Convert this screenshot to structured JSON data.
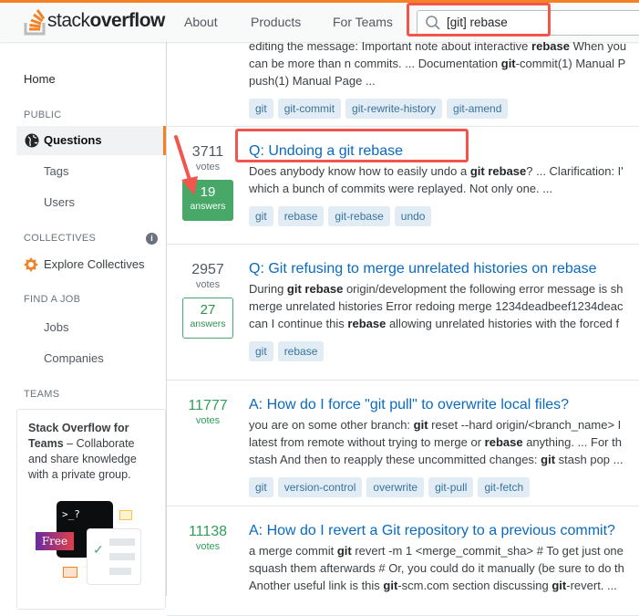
{
  "header": {
    "logo": {
      "stack": "stack",
      "overflow": "overflow"
    },
    "nav": [
      "About",
      "Products",
      "For Teams"
    ],
    "search_value": "[git] rebase"
  },
  "sidebar": {
    "home": "Home",
    "public": "PUBLIC",
    "questions": "Questions",
    "tags": "Tags",
    "users": "Users",
    "collectives": "COLLECTIVES",
    "explore": "Explore Collectives",
    "find_job": "FIND A JOB",
    "jobs": "Jobs",
    "companies": "Companies",
    "teams": "TEAMS",
    "teams_box": {
      "bold": "Stack Overflow for Teams",
      "rest": " – Collaborate and share knowledge with a private group.",
      "badge": "Free",
      "terminal": ">_?"
    }
  },
  "colors": {
    "accent": "#f48225",
    "link": "#0a6abf",
    "answered": "#48a868",
    "highlight": "#f2554b"
  },
  "posts": [
    {
      "title": "",
      "votes": "",
      "votes_label": "votes",
      "green": true,
      "answers": null,
      "accepted": false,
      "lines": [
        [
          [
            "editing the message: Important note about interactive ",
            0
          ],
          [
            "rebase",
            1
          ],
          [
            " When you",
            0
          ]
        ],
        [
          [
            "can be more than n commits. ... Documentation ",
            0
          ],
          [
            "git",
            1
          ],
          [
            "-commit(1) Manual P",
            0
          ]
        ],
        [
          [
            "push(1) Manual Page ...",
            0
          ]
        ]
      ],
      "tags": [
        "git",
        "git-commit",
        "git-rewrite-history",
        "git-amend"
      ]
    },
    {
      "title": "Q: Undoing a git rebase",
      "votes": "3711",
      "votes_label": "votes",
      "green": false,
      "answers": "19",
      "answers_label": "answers",
      "accepted": true,
      "lines": [
        [
          [
            "Does anybody know how to easily undo a ",
            0
          ],
          [
            "git rebase",
            1
          ],
          [
            "? ... Clarification: I'",
            0
          ]
        ],
        [
          [
            "which a bunch of commits were replayed. Not only one. ...",
            0
          ]
        ]
      ],
      "tags": [
        "git",
        "rebase",
        "git-rebase",
        "undo"
      ]
    },
    {
      "title": "Q: Git refusing to merge unrelated histories on rebase",
      "votes": "2957",
      "votes_label": "votes",
      "green": false,
      "answers": "27",
      "answers_label": "answers",
      "accepted": false,
      "lines": [
        [
          [
            "During ",
            0
          ],
          [
            "git rebase",
            1
          ],
          [
            " origin/development the following error message is sh",
            0
          ]
        ],
        [
          [
            "merge unrelated histories Error redoing merge 1234deadbeef1234deac",
            0
          ]
        ],
        [
          [
            "can I continue this ",
            0
          ],
          [
            "rebase",
            1
          ],
          [
            " allowing unrelated histories with the forced f",
            0
          ]
        ]
      ],
      "tags": [
        "git",
        "rebase"
      ]
    },
    {
      "title": "A: How do I force \"git pull\" to overwrite local files?",
      "votes": "11777",
      "votes_label": "votes",
      "green": true,
      "answers": null,
      "accepted": false,
      "lines": [
        [
          [
            "you are on some other branch: ",
            0
          ],
          [
            "git",
            1
          ],
          [
            " reset --hard origin/<branch_name> I",
            0
          ]
        ],
        [
          [
            "latest from remote without trying to merge or ",
            0
          ],
          [
            "rebase",
            1
          ],
          [
            " anything. ... For th",
            0
          ]
        ],
        [
          [
            "stash And then to reapply these uncommitted changes: ",
            0
          ],
          [
            "git",
            1
          ],
          [
            " stash pop ...",
            0
          ]
        ]
      ],
      "tags": [
        "git",
        "version-control",
        "overwrite",
        "git-pull",
        "git-fetch"
      ]
    },
    {
      "title": "A: How do I revert a Git repository to a previous commit?",
      "votes": "11138",
      "votes_label": "votes",
      "green": true,
      "answers": null,
      "accepted": false,
      "lines": [
        [
          [
            "a merge commit ",
            0
          ],
          [
            "git",
            1
          ],
          [
            " revert -m 1 <merge_commit_sha> # To get just one",
            0
          ]
        ],
        [
          [
            "squash them afterwards # Or, you could do it manually (be sure to do th",
            0
          ]
        ],
        [
          [
            "Another useful link is this ",
            0
          ],
          [
            "git",
            1
          ],
          [
            "-scm.com section discussing ",
            0
          ],
          [
            "git",
            1
          ],
          [
            "-revert. ...",
            0
          ]
        ]
      ],
      "tags": []
    }
  ]
}
